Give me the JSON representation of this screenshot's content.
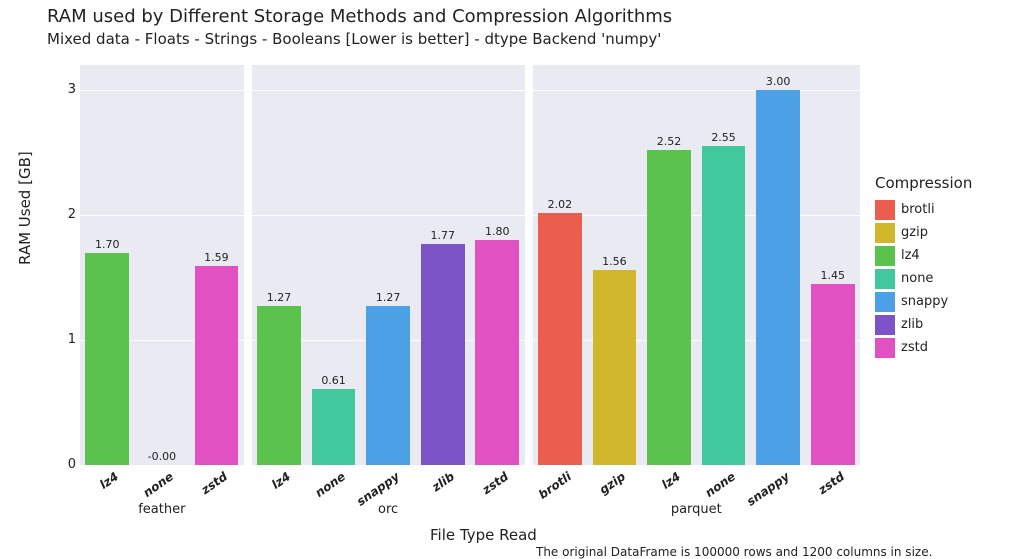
{
  "chart_data": {
    "type": "bar",
    "title": "RAM used by Different Storage Methods and Compression Algorithms",
    "subtitle": "Mixed data - Floats - Strings - Booleans [Lower is better] - dtype Backend 'numpy'",
    "xlabel": "File Type Read",
    "ylabel": "RAM Used [GB]",
    "ylim": [
      0,
      3.2
    ],
    "yticks": [
      0,
      1,
      2,
      3
    ],
    "legend_title": "Compression",
    "caption": "The original DataFrame is 100000 rows and 1200 columns in size.",
    "compression_colors": {
      "brotli": "#EB5E4E",
      "gzip": "#D1B72B",
      "lz4": "#5AC24D",
      "none": "#41C89D",
      "snappy": "#4BA0E6",
      "zlib": "#7D54C8",
      "zstd": "#E151C2"
    },
    "legend_order": [
      "brotli",
      "gzip",
      "lz4",
      "none",
      "snappy",
      "zlib",
      "zstd"
    ],
    "facets": [
      {
        "name": "feather",
        "bars": [
          {
            "compression": "lz4",
            "value": 1.7,
            "label": "1.70"
          },
          {
            "compression": "none",
            "value": 0.0,
            "label": "-0.00"
          },
          {
            "compression": "zstd",
            "value": 1.59,
            "label": "1.59"
          }
        ]
      },
      {
        "name": "orc",
        "bars": [
          {
            "compression": "lz4",
            "value": 1.27,
            "label": "1.27"
          },
          {
            "compression": "none",
            "value": 0.61,
            "label": "0.61"
          },
          {
            "compression": "snappy",
            "value": 1.27,
            "label": "1.27"
          },
          {
            "compression": "zlib",
            "value": 1.77,
            "label": "1.77"
          },
          {
            "compression": "zstd",
            "value": 1.8,
            "label": "1.80"
          }
        ]
      },
      {
        "name": "parquet",
        "bars": [
          {
            "compression": "brotli",
            "value": 2.02,
            "label": "2.02"
          },
          {
            "compression": "gzip",
            "value": 1.56,
            "label": "1.56"
          },
          {
            "compression": "lz4",
            "value": 2.52,
            "label": "2.52"
          },
          {
            "compression": "none",
            "value": 2.55,
            "label": "2.55"
          },
          {
            "compression": "snappy",
            "value": 3.0,
            "label": "3.00"
          },
          {
            "compression": "zstd",
            "value": 1.45,
            "label": "1.45"
          }
        ]
      }
    ]
  }
}
